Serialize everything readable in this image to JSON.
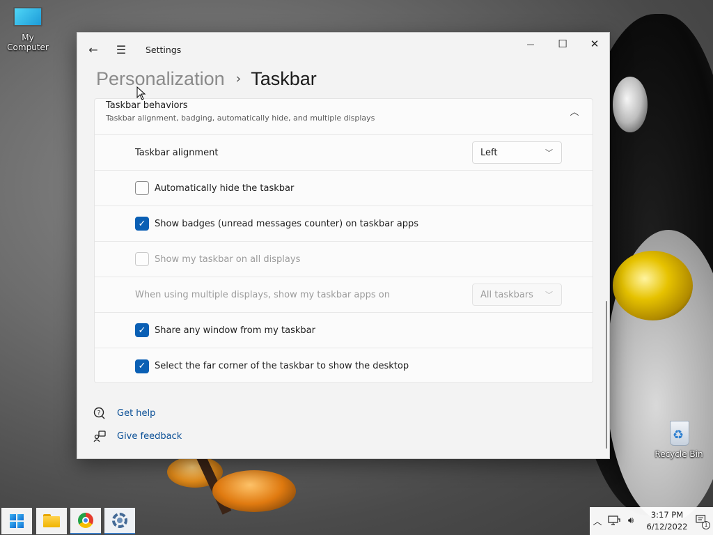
{
  "desktop": {
    "icons": [
      {
        "label": "My Computer"
      },
      {
        "label": "Recycle Bin"
      }
    ]
  },
  "window": {
    "title": "Settings",
    "breadcrumb": {
      "parent": "Personalization",
      "separator": "›",
      "current": "Taskbar"
    },
    "controls": {
      "back": "←",
      "menu": "☰",
      "minimize": "—",
      "maximize": "☐",
      "close": "✕"
    },
    "section": {
      "title": "Taskbar behaviors",
      "subtitle": "Taskbar alignment, badging, automatically hide, and multiple displays",
      "expanded": true,
      "rows": [
        {
          "type": "dropdown",
          "label": "Taskbar alignment",
          "value": "Left",
          "enabled": true
        },
        {
          "type": "checkbox",
          "label": "Automatically hide the taskbar",
          "checked": false,
          "enabled": true
        },
        {
          "type": "checkbox",
          "label": "Show badges (unread messages counter) on taskbar apps",
          "checked": true,
          "enabled": true
        },
        {
          "type": "checkbox",
          "label": "Show my taskbar on all displays",
          "checked": false,
          "enabled": false
        },
        {
          "type": "dropdown",
          "label": "When using multiple displays, show my taskbar apps on",
          "value": "All taskbars",
          "enabled": false
        },
        {
          "type": "checkbox",
          "label": "Share any window from my taskbar",
          "checked": true,
          "enabled": true
        },
        {
          "type": "checkbox",
          "label": "Select the far corner of the taskbar to show the desktop",
          "checked": true,
          "enabled": true
        }
      ]
    },
    "links": [
      {
        "label": "Get help",
        "icon": "help-icon"
      },
      {
        "label": "Give feedback",
        "icon": "feedback-icon"
      }
    ]
  },
  "taskbar": {
    "apps": [
      {
        "name": "Start",
        "icon": "windows-logo-icon"
      },
      {
        "name": "File Explorer",
        "icon": "folder-icon"
      },
      {
        "name": "Google Chrome",
        "icon": "chrome-icon"
      },
      {
        "name": "Settings",
        "icon": "gear-icon",
        "active": true
      }
    ],
    "tray": {
      "time": "3:17 PM",
      "date": "6/12/2022",
      "notification_count": "1"
    }
  },
  "colors": {
    "accent": "#0a5fb4",
    "link": "#0a4f96"
  }
}
